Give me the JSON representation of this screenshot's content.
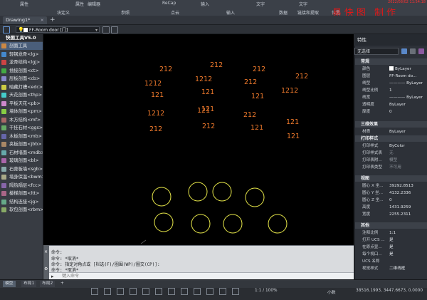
{
  "ribbon": {
    "top_labels": [
      "属性",
      "属性",
      "编辑器",
      "ReCap",
      "输入",
      "文字",
      "文字"
    ],
    "bottom_labels": [
      "块定义",
      "参照",
      "点云",
      "输入",
      "数据",
      "链接和提取",
      "位置"
    ],
    "watermark": "易快图  制作",
    "stamp": "2022/08/02 11:54:18"
  },
  "tabs": {
    "document": "Drawing1*",
    "add": "+"
  },
  "layer": {
    "selected": "FF-Room door [门]"
  },
  "palette": {
    "title": "快图工具V5.0",
    "items": [
      "剖面工具",
      "轻钢龙骨<lg>",
      "龙骨结构<lgj>",
      "插接剖面<ct>",
      "层板剖面<cb>",
      "暗藏灯槽<edc>",
      "天花剖面<thp>",
      "平板天花<pb>",
      "墙体剖面<pm>",
      "木方结构<mf>",
      "干挂石材<ggs>",
      "木板剖面<mb>",
      "夹板剖面<jbb>",
      "石材墙面<mdb>",
      "玻璃剖面<bl>",
      "石膏板墙<sgb>",
      "墙身保温<bwm>",
      "隔热隔层<fcc>",
      "楼梯剖面<ltt>",
      "结构连接<jg>",
      "软包剖面<rbm>"
    ],
    "selected_index": 0
  },
  "canvas": {
    "labels": [
      {
        "text": "212"
      },
      {
        "text": "212"
      },
      {
        "text": "212"
      },
      {
        "text": "1212"
      },
      {
        "text": "1212"
      },
      {
        "text": "212"
      },
      {
        "text": "212"
      },
      {
        "text": "1212"
      },
      {
        "text": "121"
      },
      {
        "text": "121"
      },
      {
        "text": "121"
      },
      {
        "text": "1212"
      },
      {
        "text": "121"
      },
      {
        "text": "212"
      },
      {
        "text": "212"
      },
      {
        "text": "212"
      },
      {
        "text": "121"
      },
      {
        "text": "121"
      },
      {
        "text": "121"
      },
      {
        "text": "121"
      }
    ],
    "circle_color": "#e8e84a",
    "label_color": "#f07a2c"
  },
  "command": {
    "history": [
      "命令:",
      "命令: *取消*",
      "命令: 指定对角点或 [栏选(F)/圈围(WP)/圈交(CP)]:",
      "命令: *取消*"
    ],
    "placeholder": "键入命令"
  },
  "properties": {
    "title": "特性",
    "selection": "无选择",
    "sections": {
      "general": {
        "title": "常规",
        "rows": [
          {
            "k": "颜色",
            "v": "ByLayer"
          },
          {
            "k": "图层",
            "v": "FF-Room do..."
          },
          {
            "k": "线型",
            "v": "———— ByLayer"
          },
          {
            "k": "线型比例",
            "v": "1"
          },
          {
            "k": "线宽",
            "v": "———— ByLayer"
          },
          {
            "k": "透明度",
            "v": "ByLayer"
          },
          {
            "k": "厚度",
            "v": "0"
          }
        ]
      },
      "3d": {
        "title": "三维效果",
        "rows": [
          {
            "k": "材质",
            "v": "ByLayer"
          }
        ]
      },
      "plot": {
        "title": "打印样式",
        "rows": [
          {
            "k": "打印样式",
            "v": "ByColor"
          },
          {
            "k": "打印样式表",
            "v": "无"
          },
          {
            "k": "打印表附...",
            "v": "模型"
          },
          {
            "k": "打印表类型",
            "v": "不可用"
          }
        ]
      },
      "view": {
        "title": "视图",
        "rows": [
          {
            "k": "圆心 X 坐...",
            "v": "39292.8513"
          },
          {
            "k": "圆心 Y 坐...",
            "v": "4132.2336"
          },
          {
            "k": "圆心 Z 坐...",
            "v": "0"
          },
          {
            "k": "高度",
            "v": "1431.9259"
          },
          {
            "k": "宽度",
            "v": "2255.2311"
          }
        ]
      },
      "misc": {
        "title": "其他",
        "rows": [
          {
            "k": "注释比例",
            "v": "1:1"
          },
          {
            "k": "打开 UCS ...",
            "v": "是"
          },
          {
            "k": "在原点显...",
            "v": "是"
          },
          {
            "k": "每个视口...",
            "v": "是"
          },
          {
            "k": "UCS 名称",
            "v": ""
          },
          {
            "k": "视觉样式",
            "v": "二维线框"
          }
        ]
      }
    }
  },
  "status": {
    "tabs": [
      "模型",
      "布局1",
      "布局2",
      "+"
    ],
    "scale": "1:1 / 100%",
    "units": "小数",
    "coords": "38516.1993, 3447.6673, 0.0000"
  }
}
